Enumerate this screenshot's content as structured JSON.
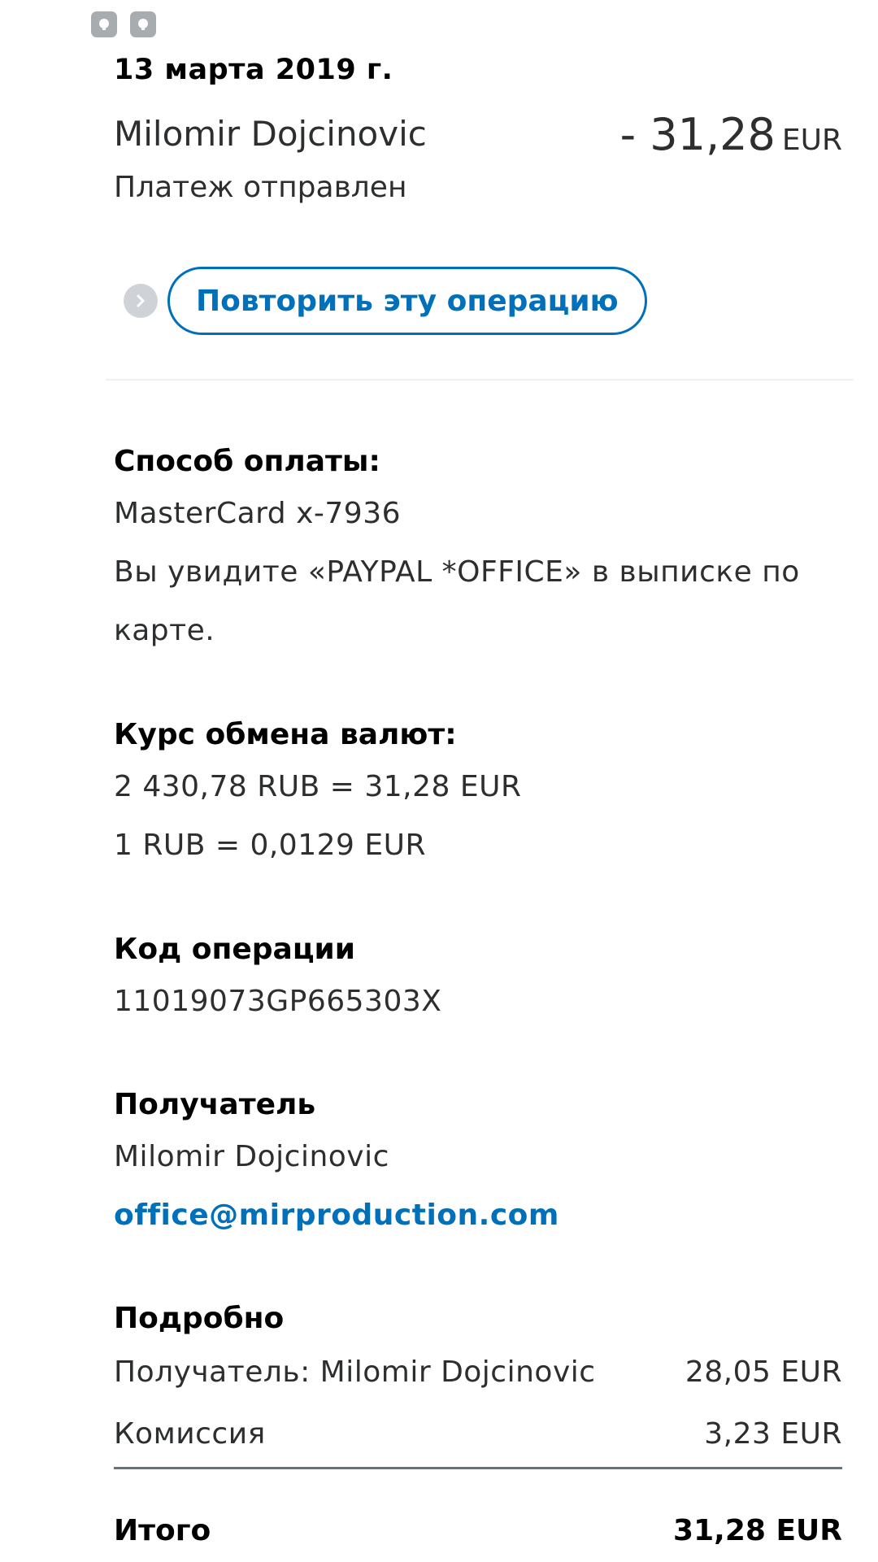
{
  "header": {
    "date": "13 марта 2019 г.",
    "merchant": "Milomir Dojcinovic",
    "amount": "- 31,28",
    "currency": "EUR",
    "status": "Платеж отправлен"
  },
  "actions": {
    "repeat_label": "Повторить эту операцию"
  },
  "payment_method": {
    "title": "Способ оплаты:",
    "card": "MasterCard x-7936",
    "statement_line1": "Вы увидите «PAYPAL *OFFICE» в выписке по",
    "statement_line2": "карте."
  },
  "exchange": {
    "title": "Курс обмена валют:",
    "conversion": "2 430,78 RUB = 31,28 EUR",
    "rate": "1 RUB = 0,0129 EUR"
  },
  "transaction": {
    "title": "Код операции",
    "id": "11019073GP665303X"
  },
  "recipient": {
    "title": "Получатель",
    "name": "Milomir Dojcinovic",
    "email": "office@mirproduction.com"
  },
  "details": {
    "title": "Подробно",
    "rows": [
      {
        "label": "Получатель: Milomir Dojcinovic",
        "value": "28,05 EUR"
      },
      {
        "label": "Комиссия",
        "value": "3,23 EUR"
      }
    ],
    "total_label": "Итого",
    "total_value": "31,28 EUR"
  },
  "icons": {
    "status_icon_1": "notification-icon",
    "status_icon_2": "notification-icon",
    "repeat": "chevron-right-icon"
  },
  "colors": {
    "accent": "#0070ba",
    "text": "#2c2e2f"
  }
}
